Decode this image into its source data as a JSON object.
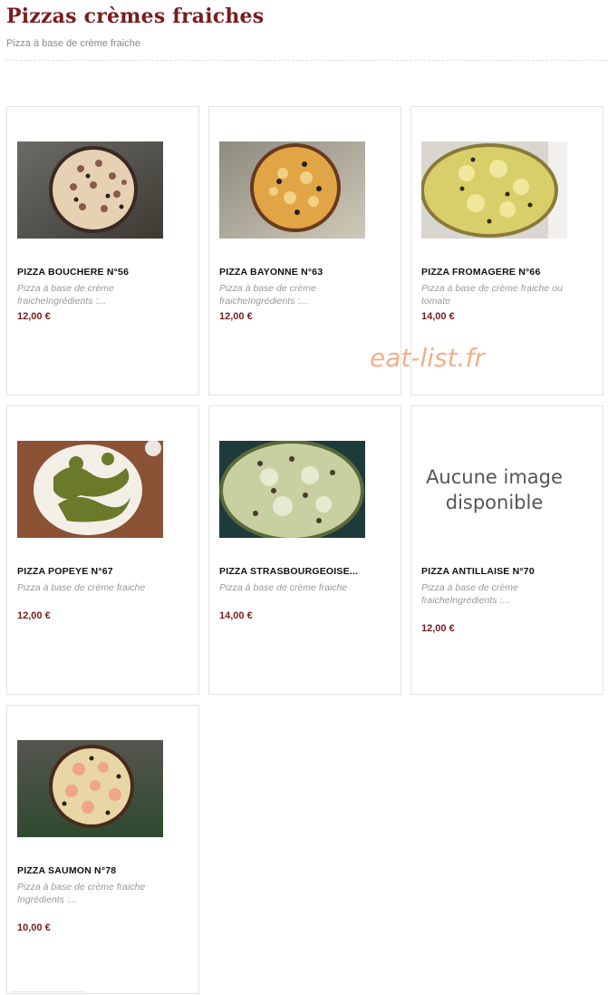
{
  "header": {
    "title": "Pizzas crèmes fraiches",
    "subtitle": "Pizza à base de crème fraiche"
  },
  "watermark": "eat-list.fr",
  "products": [
    {
      "name": "PIZZA BOUCHERE N°56",
      "desc": "Pizza à base de crème fraicheIngrédients :...",
      "price": "12,00 €",
      "image": "pizza-bouchere-photo"
    },
    {
      "name": "PIZZA BAYONNE N°63",
      "desc": "Pizza à base de crème fraicheIngrédients :...",
      "price": "12,00 €",
      "image": "pizza-bayonne-photo"
    },
    {
      "name": "PIZZA FROMAGERE N°66",
      "desc": "Pizza à base de crème fraiche ou tomate",
      "price": "14,00 €",
      "image": "pizza-fromagere-photo"
    },
    {
      "name": "PIZZA POPEYE N°67",
      "desc": "Pizza à base de crème fraiche",
      "price": "12,00 €",
      "image": "pizza-popeye-photo"
    },
    {
      "name": "PIZZA STRASBOURGEOISE...",
      "desc": "Pizza à base de crème fraiche",
      "price": "14,00 €",
      "image": "pizza-strasbourgeoise-photo"
    },
    {
      "name": "PIZZA ANTILLAISE N°70",
      "desc": "Pizza à base de crème fraicheIngrédients :...",
      "price": "12,00 €",
      "no_image_text": "Aucune image disponible"
    },
    {
      "name": "PIZZA SAUMON N°78",
      "desc": "Pizza à base de crème fraiche Ingrédients :...",
      "price": "10,00 €",
      "image": "pizza-saumon-photo"
    }
  ]
}
